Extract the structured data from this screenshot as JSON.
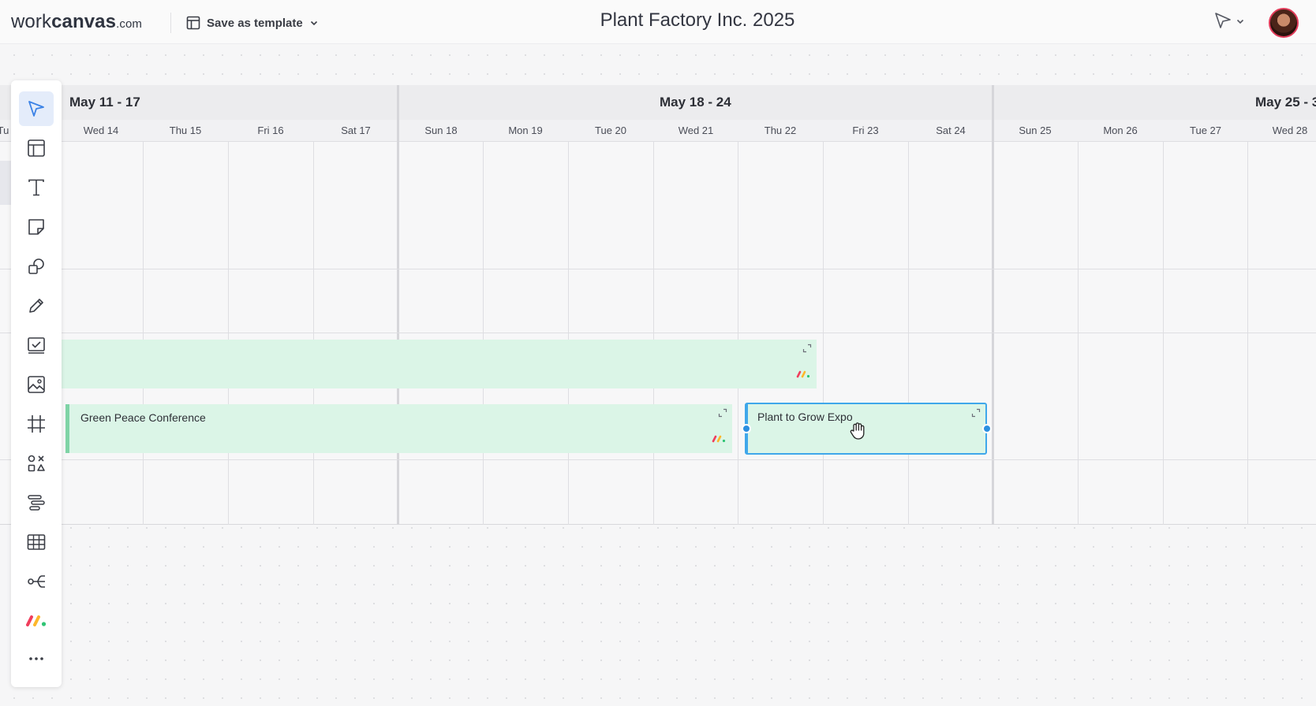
{
  "app": {
    "logo_word1": "work",
    "logo_word2": "canvas",
    "logo_domain": ".com",
    "template_button_label": "Save as template",
    "board_title": "Plant Factory Inc. 2025"
  },
  "calendar": {
    "weeks": [
      {
        "label": "May 11 - 17"
      },
      {
        "label": "May 18 - 24"
      },
      {
        "label": "May 25 - 3"
      }
    ],
    "partial_day_label": "Tu",
    "days": [
      {
        "label": "Wed 14"
      },
      {
        "label": "Thu 15"
      },
      {
        "label": "Fri 16"
      },
      {
        "label": "Sat 17"
      },
      {
        "label": "Sun 18"
      },
      {
        "label": "Mon 19"
      },
      {
        "label": "Tue 20"
      },
      {
        "label": "Wed 21"
      },
      {
        "label": "Thu 22"
      },
      {
        "label": "Fri 23"
      },
      {
        "label": "Sat 24"
      },
      {
        "label": "Sun 25"
      },
      {
        "label": "Mon 26"
      },
      {
        "label": "Tue 27"
      },
      {
        "label": "Wed 28"
      }
    ]
  },
  "events": [
    {
      "title": "",
      "start": "May 14",
      "end": "Thu 22"
    },
    {
      "title": "Green Peace Conference",
      "start": "Wed 14",
      "end": "Wed 21"
    },
    {
      "title": "Plant to Grow Expo",
      "start": "Thu 22",
      "end": "Sat 24",
      "selected": true
    }
  ],
  "toolbar": {
    "tools": [
      {
        "icon": "select-pointer-icon",
        "active": true
      },
      {
        "icon": "layout-template-icon"
      },
      {
        "icon": "text-icon"
      },
      {
        "icon": "sticky-note-icon"
      },
      {
        "icon": "shapes-icon"
      },
      {
        "icon": "pen-icon"
      },
      {
        "icon": "checklist-icon"
      },
      {
        "icon": "image-icon"
      },
      {
        "icon": "frame-icon"
      },
      {
        "icon": "diagram-shapes-icon"
      },
      {
        "icon": "timeline-icon"
      },
      {
        "icon": "table-icon"
      },
      {
        "icon": "mind-map-icon"
      },
      {
        "icon": "monday-logo-icon"
      },
      {
        "icon": "more-icon"
      }
    ]
  },
  "colors": {
    "accent": "#3fa7ea",
    "event_fill": "#dbf5e7",
    "event_bar": "#7fd3a6",
    "avatar_ring": "#e23c5a"
  }
}
